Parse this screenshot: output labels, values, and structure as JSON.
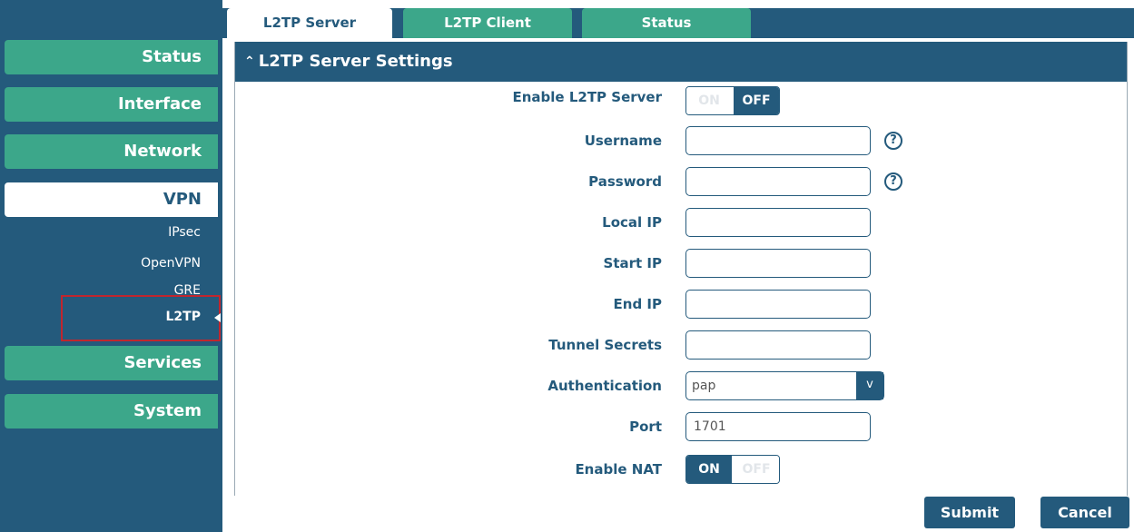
{
  "sidebar": {
    "items": [
      {
        "label": "Status"
      },
      {
        "label": "Interface"
      },
      {
        "label": "Network"
      },
      {
        "label": "VPN"
      },
      {
        "label": "Services"
      },
      {
        "label": "System"
      }
    ],
    "vpn_subitems": [
      {
        "label": "IPsec"
      },
      {
        "label": "OpenVPN"
      },
      {
        "label": "GRE"
      },
      {
        "label": "L2TP"
      }
    ],
    "active_item": "VPN",
    "selected_subitem": "L2TP"
  },
  "tabs": [
    {
      "label": "L2TP Server"
    },
    {
      "label": "L2TP Client"
    },
    {
      "label": "Status"
    }
  ],
  "active_tab": "L2TP Server",
  "panel": {
    "title": "L2TP Server Settings",
    "fields": {
      "enable_l2tp_server": {
        "label": "Enable L2TP Server",
        "on_label": "ON",
        "off_label": "OFF",
        "value": "OFF"
      },
      "username": {
        "label": "Username",
        "value": ""
      },
      "password": {
        "label": "Password",
        "value": ""
      },
      "local_ip": {
        "label": "Local IP",
        "value": ""
      },
      "start_ip": {
        "label": "Start IP",
        "value": ""
      },
      "end_ip": {
        "label": "End IP",
        "value": ""
      },
      "tunnel_secrets": {
        "label": "Tunnel Secrets",
        "value": ""
      },
      "authentication": {
        "label": "Authentication",
        "value": "pap"
      },
      "port": {
        "label": "Port",
        "value": "1701"
      },
      "enable_nat": {
        "label": "Enable NAT",
        "on_label": "ON",
        "off_label": "OFF",
        "value": "ON"
      }
    }
  },
  "buttons": {
    "submit": "Submit",
    "cancel": "Cancel"
  },
  "icons": {
    "help": "?",
    "caret_up": "^",
    "dropdown": "v"
  },
  "colors": {
    "primary": "#245a7c",
    "accent": "#3ca78a",
    "highlight": "#c0262e"
  }
}
